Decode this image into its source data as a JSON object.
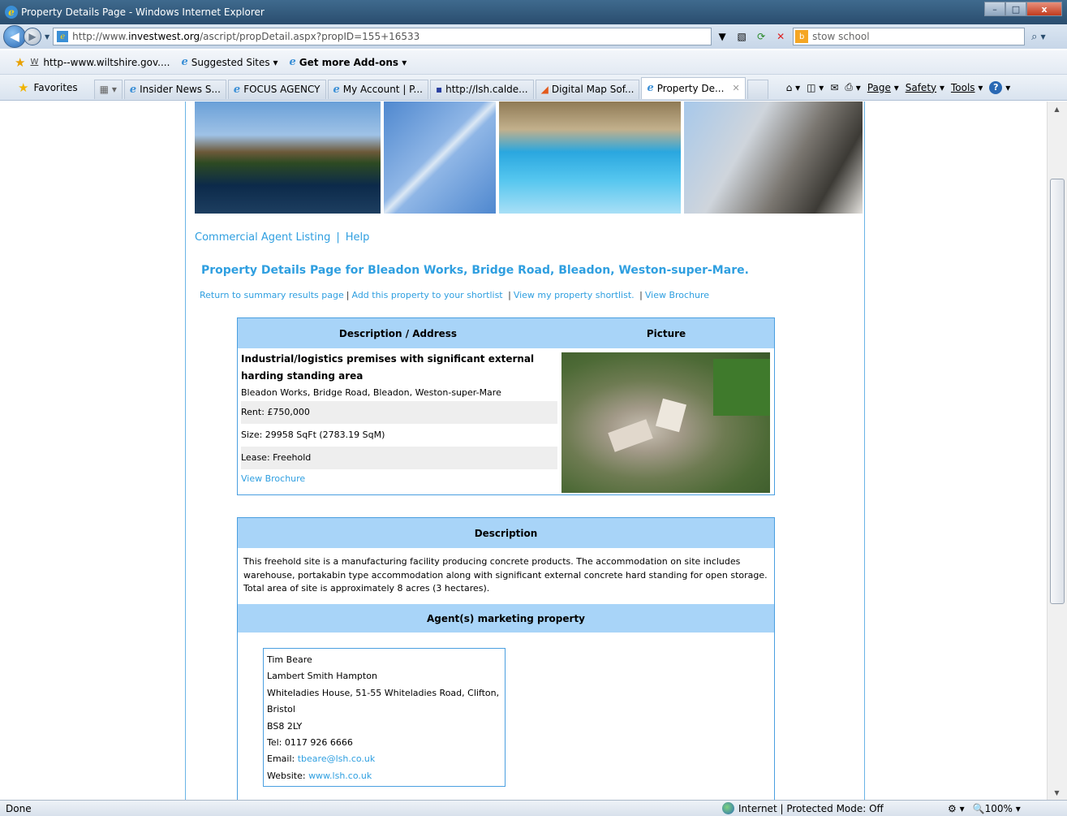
{
  "window": {
    "title": "Property Details Page - Windows Internet Explorer",
    "minimize": "–",
    "maximize": "□",
    "close": "x"
  },
  "address_bar": {
    "url_prefix": "http://www.",
    "url_domain": "investwest.org",
    "url_path": "/ascript/propDetail.aspx?propID=155+16533",
    "search_value": "stow school"
  },
  "links_bar": {
    "items": [
      "http--www.wiltshire.gov....",
      "Suggested Sites",
      "Get more Add-ons"
    ]
  },
  "favorites_bar": {
    "favorites_label": "Favorites",
    "tabs": [
      "Insider News S...",
      "FOCUS AGENCY",
      "My Account | P...",
      "http://lsh.calde...",
      "Digital Map Sof...",
      "Property De..."
    ],
    "commands": [
      "Page",
      "Safety",
      "Tools"
    ]
  },
  "page": {
    "top_nav": [
      "Commercial Agent Listing",
      "Help"
    ],
    "heading": "Property Details Page for Bleadon Works, Bridge Road, Bleadon, Weston-super-Mare.",
    "actions": [
      "Return to summary results page",
      "Add this property to your shortlist",
      "View my property shortlist.",
      "View Brochure"
    ],
    "details": {
      "col_description": "Description / Address",
      "col_picture": "Picture",
      "title": "Industrial/logistics premises with significant external harding standing area",
      "address": "Bleadon Works, Bridge Road, Bleadon, Weston-super-Mare",
      "rent": "Rent: £750,000",
      "size": "Size: 29958 SqFt (2783.19 SqM)",
      "lease": "Lease: Freehold",
      "brochure_link": "View Brochure"
    },
    "description": {
      "heading": "Description",
      "text": "This freehold site is a manufacturing facility producing concrete products. The accommodation on site includes warehouse, portakabin type accommodation along with significant external concrete hard standing for open storage. Total area of site is approximately 8 acres (3 hectares)."
    },
    "agent": {
      "heading": "Agent(s) marketing property",
      "name": "Tim  Beare",
      "company": "Lambert Smith Hampton",
      "address": "Whiteladies House, 51-55 Whiteladies Road, Clifton, Bristol",
      "postcode": "BS8 2LY",
      "tel": "Tel: 0117 926 6666",
      "email_label": "Email:",
      "email": "tbeare@lsh.co.uk",
      "website_label": "Website:",
      "website": "www.lsh.co.uk"
    }
  },
  "status_bar": {
    "status": "Done",
    "zone": "Internet | Protected Mode: Off",
    "zoom": "100%"
  }
}
